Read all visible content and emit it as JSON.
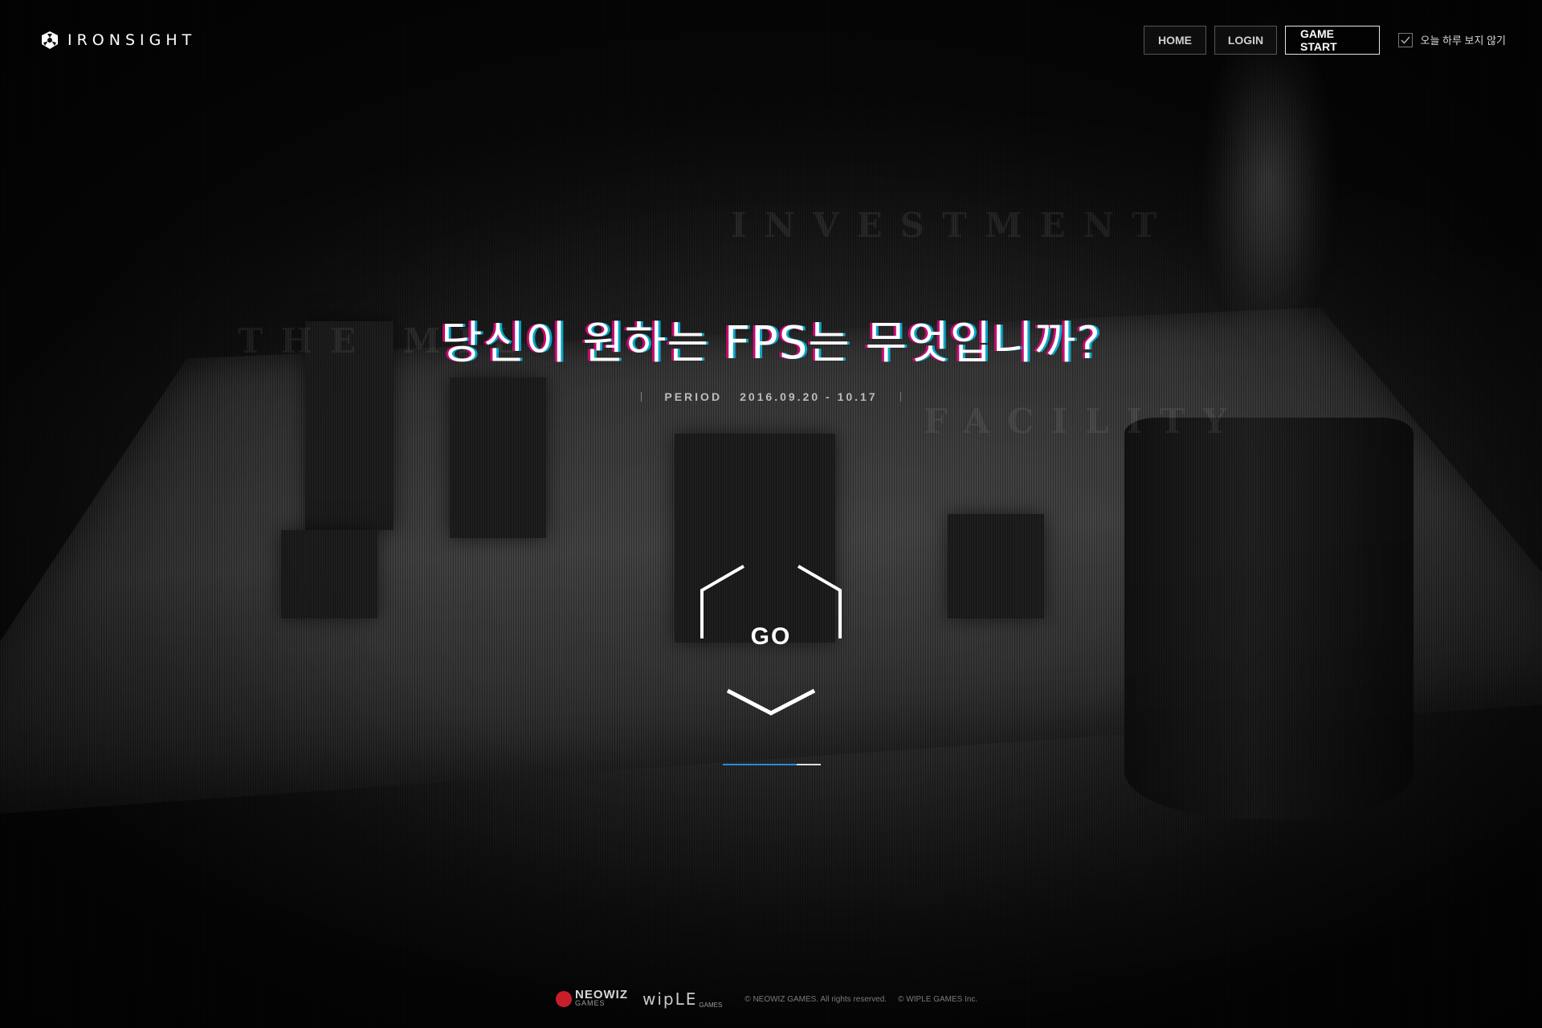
{
  "brand": {
    "name": "IRONSIGHT",
    "icon": "ironsight-logo-icon"
  },
  "nav": {
    "home": "HOME",
    "login": "LOGIN",
    "game_start": "GAME START"
  },
  "skip_today": {
    "label": "오늘 하루 보지 않기",
    "checked": true
  },
  "hero": {
    "headline": "당신이 원하는 FPS는 무엇입니까?",
    "period_label": "PERIOD",
    "period_dates": "2016.09.20 - 10.17",
    "go_label": "GO",
    "progress": 0.75
  },
  "background_text": {
    "investment": "INVESTMENT",
    "military": "THE MIL",
    "facility": "FACILITY"
  },
  "footer": {
    "neowiz_name": "NEOWIZ",
    "neowiz_sub": "GAMES",
    "wiple_name": "wipLE",
    "wiple_sub": "GAMES",
    "copyright_1": "© NEOWIZ GAMES. All rights reserved.",
    "copyright_2": "© WIPLE GAMES Inc."
  },
  "colors": {
    "accent_blue": "#2a8bd1",
    "neowiz_red": "#c81e2a",
    "glitch_pink": "#ff008c",
    "glitch_cyan": "#00d2ff"
  }
}
